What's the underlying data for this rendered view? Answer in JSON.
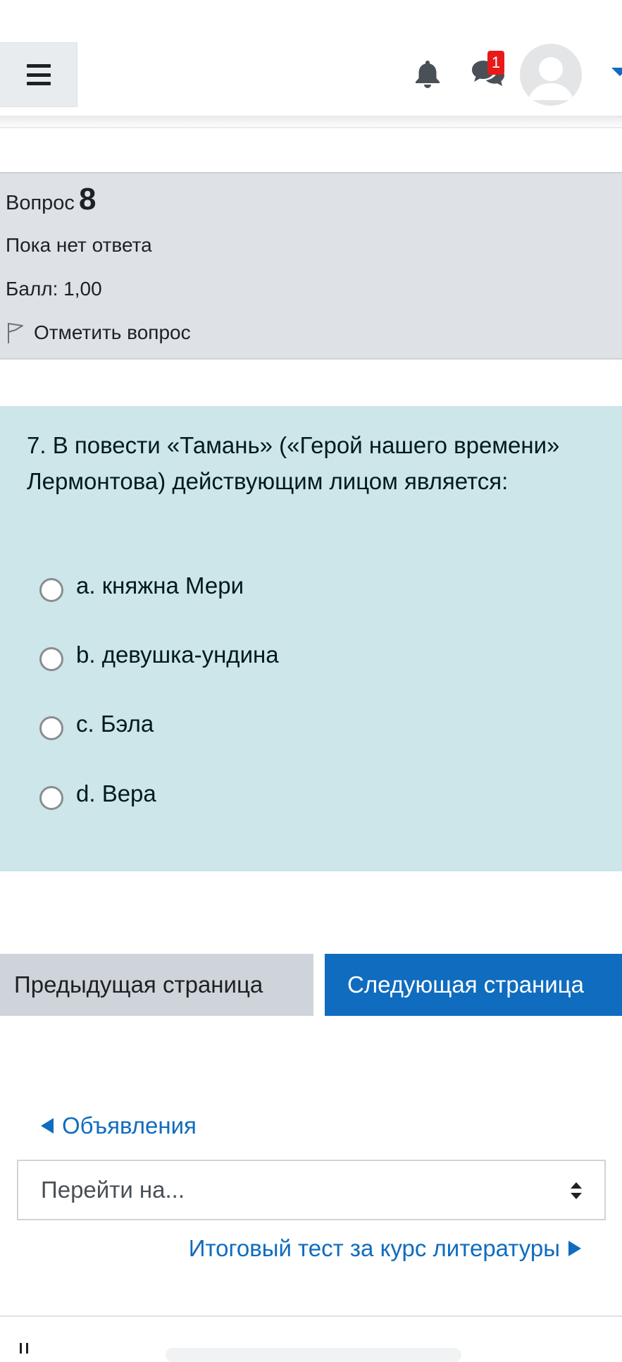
{
  "navbar": {
    "notifications_icon": "bell-icon",
    "messages_icon": "chat-bubbles-icon",
    "messages_badge": "1",
    "menu_icon": "hamburger-icon",
    "avatar_icon": "user-avatar-icon"
  },
  "question_info": {
    "label": "Вопрос",
    "number": "8",
    "state": "Пока нет ответа",
    "grade": "Балл: 1,00",
    "flag_label": "Отметить вопрос",
    "flag_icon": "flag-icon"
  },
  "question": {
    "text": "7. В повести «Тамань» («Герой нашего времени» Лермонтова) действующим лицом является:",
    "answers": [
      {
        "label": "a. княжна Мери",
        "selected": false
      },
      {
        "label": "b. девушка-ундина",
        "selected": false
      },
      {
        "label": "c. Бэла",
        "selected": false
      },
      {
        "label": "d. Вера",
        "selected": false
      }
    ]
  },
  "navigation": {
    "prev_label": "Предыдущая страница",
    "next_label": "Следующая страница"
  },
  "activity_nav": {
    "prev_link": "Объявления",
    "jump_placeholder": "Перейти на...",
    "next_link": "Итоговый тест за курс литературы"
  },
  "colors": {
    "primary": "#0f6cbf",
    "info_bg": "#dee2e6",
    "question_bg": "#cce6ea",
    "badge": "#e81919"
  }
}
